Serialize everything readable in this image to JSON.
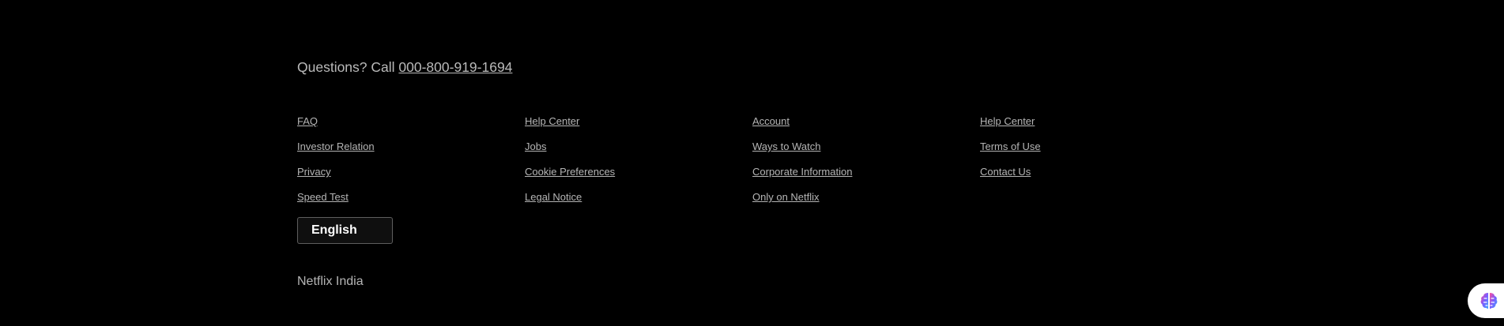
{
  "contact": {
    "prefix": "Questions? Call ",
    "phone": "000-800-919-1694"
  },
  "footer_links": {
    "col1": [
      "FAQ",
      "Investor Relation",
      "Privacy",
      "Speed Test"
    ],
    "col2": [
      "Help Center",
      "Jobs",
      "Cookie Preferences",
      "Legal Notice"
    ],
    "col3": [
      "Account",
      "Ways to Watch",
      "Corporate Information",
      "Only on Netflix"
    ],
    "col4": [
      "Help Center",
      "Terms of Use",
      "Contact Us"
    ]
  },
  "language_select": {
    "selected": "English"
  },
  "region": "Netflix India",
  "assistant_widget": {
    "icon": "brain-icon",
    "colors": [
      "#ff4f9a",
      "#7b5cff",
      "#3fa9ff"
    ]
  },
  "colors": {
    "background": "#000000",
    "text": "#b3b3b3",
    "select_text": "#ffffff"
  }
}
